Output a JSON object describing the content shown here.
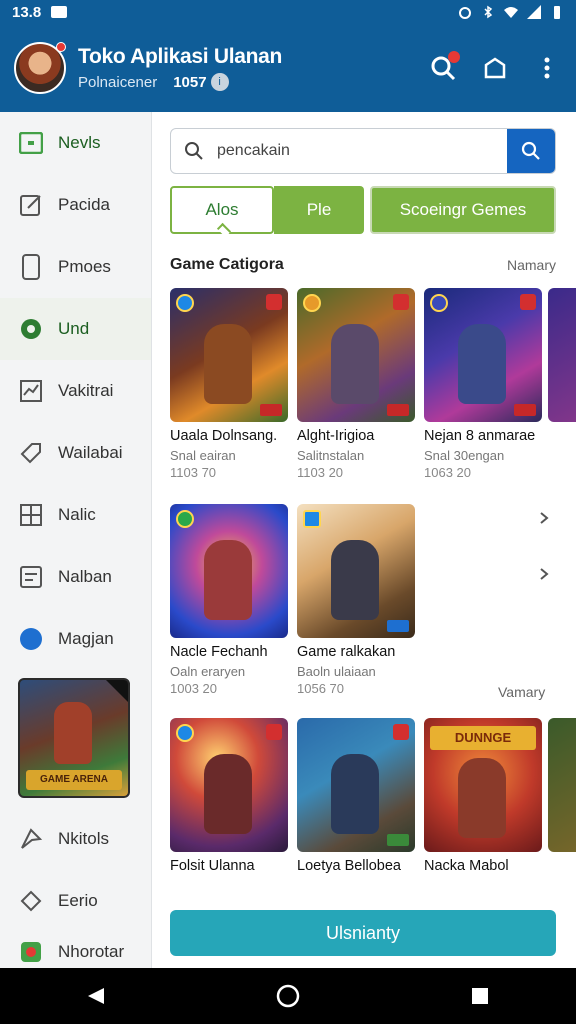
{
  "status_bar": {
    "time": "13.8"
  },
  "app_bar": {
    "title": "Toko Aplikasi Ulanan",
    "subtitle": "Polnaicener",
    "count": "1057"
  },
  "sidebar": {
    "items": [
      {
        "label": "Nevls",
        "icon": "square-icon",
        "active": true
      },
      {
        "label": "Pacida",
        "icon": "edit-icon"
      },
      {
        "label": "Pmoes",
        "icon": "phone-icon"
      },
      {
        "label": "Und",
        "icon": "gear-icon",
        "active": true
      },
      {
        "label": "Vakitrai",
        "icon": "chart-icon"
      },
      {
        "label": "Wailabai",
        "icon": "tag-icon"
      },
      {
        "label": "Nalic",
        "icon": "grid-icon"
      },
      {
        "label": "Nalban",
        "icon": "list-icon"
      },
      {
        "label": "Magjan",
        "icon": "globe-icon"
      }
    ],
    "featured_banner": "GAME ARENA",
    "items_bottom": [
      {
        "label": "Nkitols",
        "icon": "send-icon"
      },
      {
        "label": "Eerio",
        "icon": "compass-icon"
      },
      {
        "label": "Nhorotar",
        "icon": "app-icon"
      }
    ]
  },
  "search": {
    "value": "pencakain"
  },
  "tabs": [
    {
      "label": "Alos"
    },
    {
      "label": "Ple"
    },
    {
      "label": "Scoeingr Gemes"
    }
  ],
  "section1": {
    "title": "Game Catigora",
    "link": "Namary",
    "cards": [
      {
        "name": "Uaala Dolnsang.",
        "meta": "Snal eairan",
        "num": "1103 70"
      },
      {
        "name": "Alght-Irigioa",
        "meta": "Salitnstalan",
        "num": "1103 20"
      },
      {
        "name": "Nejan 8 anmarae",
        "meta": "Snal 30engan",
        "num": "1063 20"
      }
    ]
  },
  "section2": {
    "link": "Vamary",
    "cards": [
      {
        "name": "Nacle Fechanh",
        "meta": "Oaln eraryen",
        "num": "1003 20"
      },
      {
        "name": "Game ralkakan",
        "meta": "Baoln ulaiaan",
        "num": "1056 70"
      }
    ]
  },
  "section3": {
    "cards": [
      {
        "name": "Folsit Ulanna",
        "meta": "",
        "num": ""
      },
      {
        "name": "Loetya Bellobea",
        "meta": "",
        "num": ""
      },
      {
        "name": "Nacka Mabol",
        "meta": "",
        "num": ""
      }
    ],
    "thumb_title": "DUNNGE"
  },
  "cta_label": "Ulsnianty"
}
